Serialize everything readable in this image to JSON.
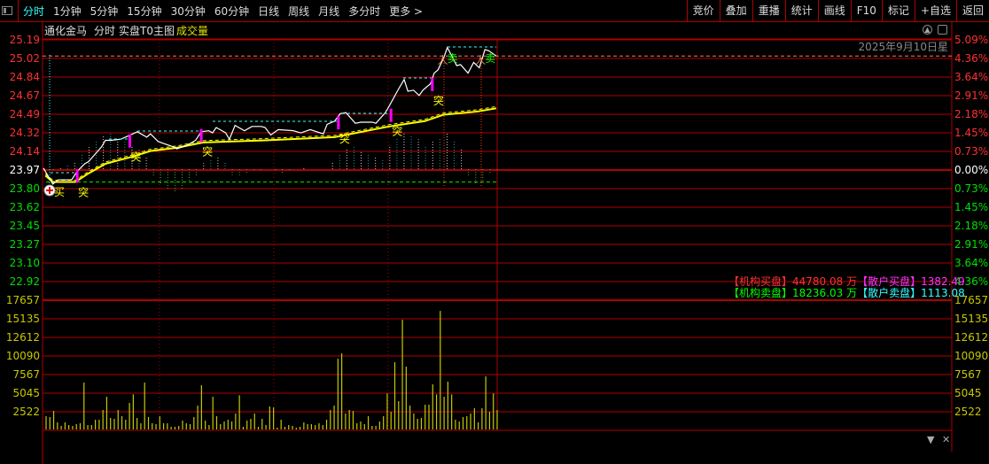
{
  "toolbar": {
    "periods": [
      "分时",
      "1分钟",
      "5分钟",
      "15分钟",
      "30分钟",
      "60分钟",
      "日线",
      "周线",
      "月线",
      "多分时",
      "更多 >"
    ],
    "right_buttons": [
      "竞价",
      "叠加",
      "重播",
      "统计",
      "画线",
      "F10",
      "标记",
      "+自选",
      "返回"
    ]
  },
  "header": {
    "stock_name": "通化金马",
    "mode": "分时",
    "indicator": "实盘T0主图",
    "volume_label": "成交量",
    "date": "2025年9月10日星"
  },
  "colors": {
    "up": "#ff3030",
    "down": "#00e000",
    "grid": "#b00000",
    "price": "#ffffff",
    "avg": "#ffff00",
    "volume": "#c8c800",
    "cyan": "#33ffff",
    "magenta": "#ff00ff"
  },
  "price_axis": {
    "labels": [
      "25.19",
      "25.02",
      "24.84",
      "24.67",
      "24.49",
      "24.32",
      "24.14",
      "23.97",
      "23.80",
      "23.62",
      "23.45",
      "23.27",
      "23.10",
      "22.92"
    ],
    "percent": [
      "5.09%",
      "4.36%",
      "3.64%",
      "2.91%",
      "2.18%",
      "1.45%",
      "0.73%",
      "0.00%",
      "0.73%",
      "1.45%",
      "2.18%",
      "2.91%",
      "3.64%",
      "4.36%"
    ],
    "prev_close": 23.97
  },
  "volume_axis": {
    "labels": [
      "17657",
      "15135",
      "12612",
      "10090",
      "7567",
      "5045",
      "2522"
    ],
    "max": 17657
  },
  "legend": {
    "inst_buy_label": "【机构买盘】",
    "inst_buy_value": "44780.08 万",
    "retail_buy_label": "【散户买盘】",
    "retail_buy_value": "1382.49",
    "inst_sell_label": "【机构卖盘】",
    "inst_sell_value": "18236.03 万",
    "retail_sell_label": "【散户卖盘】",
    "retail_sell_value": "1113.08"
  },
  "signals": {
    "break_label": "突",
    "buy_label": "买",
    "sell_label": "卖"
  },
  "chart_data": {
    "type": "line",
    "price": [
      [
        0,
        23.98
      ],
      [
        5,
        23.83
      ],
      [
        8,
        23.87
      ],
      [
        15,
        23.87
      ],
      [
        18,
        23.95
      ],
      [
        22,
        24.02
      ],
      [
        24,
        24.04
      ],
      [
        26,
        24.08
      ],
      [
        31,
        24.18
      ],
      [
        33,
        24.24
      ],
      [
        36,
        24.24
      ],
      [
        41,
        24.25
      ],
      [
        45,
        24.28
      ],
      [
        50,
        24.32
      ],
      [
        55,
        24.27
      ],
      [
        57,
        24.3
      ],
      [
        61,
        24.23
      ],
      [
        64,
        24.21
      ],
      [
        69,
        24.18
      ],
      [
        71,
        24.16
      ],
      [
        76,
        24.19
      ],
      [
        81,
        24.24
      ],
      [
        84,
        24.32
      ],
      [
        88,
        24.33
      ],
      [
        90,
        24.31
      ],
      [
        92,
        24.36
      ],
      [
        97,
        24.31
      ],
      [
        99,
        24.25
      ],
      [
        102,
        24.38
      ],
      [
        107,
        24.33
      ],
      [
        111,
        24.37
      ],
      [
        116,
        24.37
      ],
      [
        118,
        24.36
      ],
      [
        121,
        24.29
      ],
      [
        125,
        24.34
      ],
      [
        133,
        24.33
      ],
      [
        137,
        24.31
      ],
      [
        142,
        24.34
      ],
      [
        149,
        24.3
      ],
      [
        151,
        24.39
      ],
      [
        155,
        24.42
      ],
      [
        158,
        24.49
      ],
      [
        161,
        24.5
      ],
      [
        166,
        24.4
      ],
      [
        169,
        24.41
      ],
      [
        175,
        24.41
      ],
      [
        177,
        24.4
      ],
      [
        182,
        24.5
      ],
      [
        184,
        24.56
      ],
      [
        189,
        24.72
      ],
      [
        192,
        24.81
      ],
      [
        194,
        24.7
      ],
      [
        197,
        24.71
      ],
      [
        200,
        24.66
      ],
      [
        202,
        24.71
      ],
      [
        206,
        24.77
      ],
      [
        208,
        24.87
      ],
      [
        210,
        24.9
      ],
      [
        213,
        25.01
      ],
      [
        215,
        25.11
      ],
      [
        220,
        24.94
      ],
      [
        222,
        24.95
      ],
      [
        226,
        24.87
      ],
      [
        229,
        24.97
      ],
      [
        232,
        24.92
      ],
      [
        235,
        25.09
      ],
      [
        237,
        25.08
      ],
      [
        241,
        25.03
      ]
    ],
    "avg_price": [
      [
        1,
        23.91
      ],
      [
        5,
        23.85
      ],
      [
        17,
        23.85
      ],
      [
        24,
        23.93
      ],
      [
        33,
        24.02
      ],
      [
        48,
        24.09
      ],
      [
        57,
        24.14
      ],
      [
        71,
        24.17
      ],
      [
        85,
        24.22
      ],
      [
        118,
        24.24
      ],
      [
        155,
        24.27
      ],
      [
        184,
        24.37
      ],
      [
        203,
        24.42
      ],
      [
        213,
        24.48
      ],
      [
        231,
        24.51
      ],
      [
        241,
        24.54
      ]
    ],
    "volume": [
      1800,
      1680,
      2520,
      960,
      480,
      960,
      600,
      480,
      720,
      840,
      6360,
      600,
      600,
      1320,
      1320,
      2640,
      4440,
      1560,
      1440,
      2640,
      1800,
      1320,
      3600,
      4760,
      1560,
      840,
      6360,
      1680,
      840,
      720,
      1800,
      840,
      840,
      360,
      360,
      480,
      1200,
      840,
      720,
      1680,
      3240,
      6000,
      1200,
      600,
      4440,
      1800,
      720,
      1080,
      1320,
      1080,
      2160,
      4640,
      360,
      1200,
      1440,
      2160,
      360,
      1440,
      600,
      3120,
      3000,
      240,
      1320,
      360,
      600,
      480,
      240,
      360,
      960,
      720,
      720,
      600,
      840,
      600,
      1320,
      2640,
      3240,
      9600,
      10320,
      2160,
      2640,
      2520,
      840,
      1080,
      720,
      1800,
      480,
      480,
      1080,
      1800,
      4880,
      2400,
      9120,
      3840,
      14880,
      8520,
      3240,
      2160,
      1440,
      1560,
      3360,
      3360,
      6120,
      4760,
      16080,
      4440,
      6480,
      4760,
      1320,
      1080,
      1680,
      1800,
      2160,
      2880,
      960,
      2880,
      7200,
      2400,
      4880,
      2640
    ],
    "flow": [
      0,
      -5,
      5,
      10,
      20,
      40,
      55,
      70,
      85,
      90,
      80,
      70,
      60,
      50,
      30,
      -20,
      -40,
      -50,
      -60,
      -50,
      -30,
      -20,
      15,
      25,
      30,
      20,
      -15,
      -15,
      -10,
      -5,
      -5,
      0,
      -5,
      -10,
      -5,
      0,
      5,
      0,
      0,
      0,
      20,
      40,
      50,
      55,
      45,
      40,
      30,
      25,
      60,
      80,
      90,
      85,
      75,
      60,
      70,
      80,
      90,
      70,
      50,
      -20,
      -40,
      -30,
      -10,
      -5
    ],
    "break_signals": [
      [
        18,
        23.95
      ],
      [
        46,
        24.28
      ],
      [
        84,
        24.33
      ],
      [
        157,
        24.45
      ],
      [
        185,
        24.52
      ],
      [
        207,
        24.81
      ]
    ],
    "buy_signal": [
      4,
      23.83
    ],
    "sell_signals": [
      [
        214,
        25.02
      ],
      [
        234,
        25.03
      ]
    ],
    "levels": {
      "high_dash": 25.03,
      "low_dash": 23.85
    },
    "ylim": [
      22.75,
      25.19
    ]
  }
}
